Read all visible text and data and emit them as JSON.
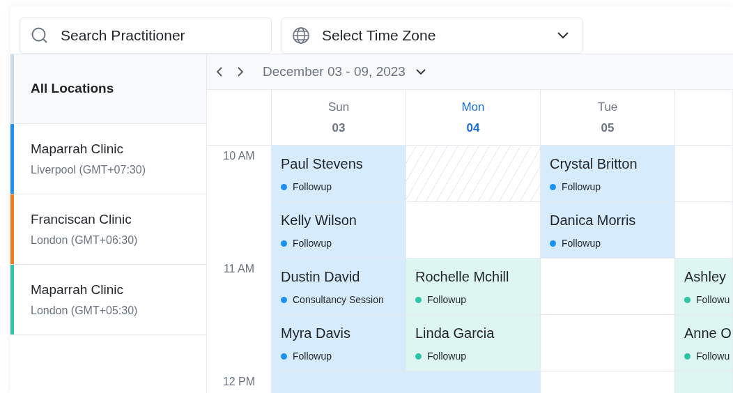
{
  "search": {
    "placeholder": "Search Practitioner"
  },
  "timezone": {
    "placeholder": "Select Time Zone"
  },
  "locations_header": "All Locations",
  "locations": [
    {
      "name": "Maparrah Clinic",
      "detail": "Liverpool (GMT+07:30)",
      "color": "#1e90f0"
    },
    {
      "name": "Franciscan Clinic",
      "detail": "London (GMT+06:30)",
      "color": "#f07a1e"
    },
    {
      "name": "Maparrah Clinic",
      "detail": "London (GMT+05:30)",
      "color": "#2ec4a8"
    }
  ],
  "calendar": {
    "range": "December 03 - 09, 2023",
    "times": [
      "10 AM",
      "11 AM",
      "12 PM"
    ],
    "columns": [
      {
        "day": {
          "weekday": "Sun",
          "date": "03",
          "selected": false
        },
        "slots": [
          {
            "kind": "event",
            "name": "Paul Stevens",
            "type": "Followup",
            "color": "#1e90f0"
          },
          {
            "kind": "event",
            "name": "Kelly Wilson",
            "type": "Followup",
            "color": "#1e90f0"
          },
          {
            "kind": "event",
            "name": "Dustin David",
            "type": "Consultancy Session",
            "color": "#1e90f0"
          },
          {
            "kind": "event",
            "name": "Myra Davis",
            "type": "Followup",
            "color": "#1e90f0"
          },
          {
            "kind": "busy",
            "color": "#d6ecfc"
          }
        ]
      },
      {
        "day": {
          "weekday": "Mon",
          "date": "04",
          "selected": true
        },
        "slots": [
          {
            "kind": "blocked"
          },
          {
            "kind": "empty"
          },
          {
            "kind": "event",
            "name": "Rochelle Mchill",
            "type": "Followup",
            "color": "#2ec4a8"
          },
          {
            "kind": "event",
            "name": "Linda Garcia",
            "type": "Followup",
            "color": "#2ec4a8"
          },
          {
            "kind": "busy",
            "color": "#d6ecfc"
          }
        ]
      },
      {
        "day": {
          "weekday": "Tue",
          "date": "05",
          "selected": false
        },
        "slots": [
          {
            "kind": "event",
            "name": "Crystal Britton",
            "type": "Followup",
            "color": "#1e90f0"
          },
          {
            "kind": "event",
            "name": "Danica Morris",
            "type": "Followup",
            "color": "#1e90f0"
          },
          {
            "kind": "empty"
          },
          {
            "kind": "empty"
          },
          {
            "kind": "empty"
          }
        ]
      },
      {
        "slots": [
          {
            "kind": "empty"
          },
          {
            "kind": "empty"
          },
          {
            "kind": "event",
            "name": "Ashley",
            "type": "Followu",
            "color": "#2ec4a8"
          },
          {
            "kind": "event",
            "name": "Anne O",
            "type": "Followu",
            "color": "#2ec4a8"
          },
          {
            "kind": "busy",
            "color": "#ddf6f1"
          }
        ]
      }
    ]
  }
}
